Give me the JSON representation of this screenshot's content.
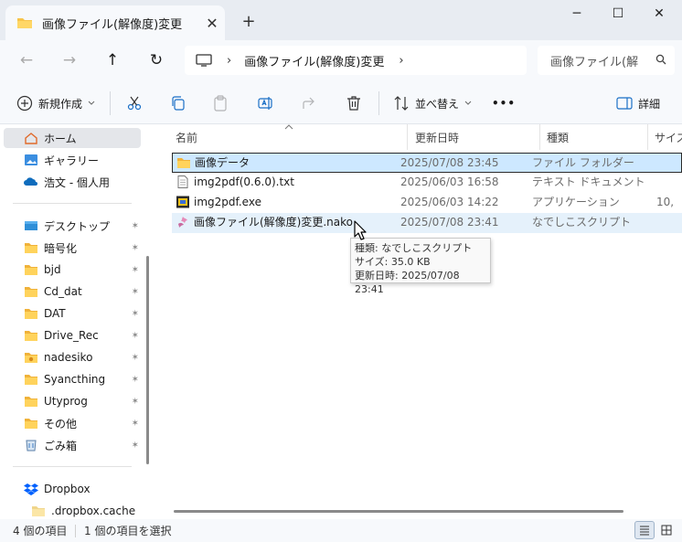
{
  "window": {
    "tab_title": "画像ファイル(解像度)変更",
    "tab_close": "✕",
    "new_tab": "+",
    "minimize": "─",
    "maximize": "☐",
    "close": "✕"
  },
  "nav": {
    "back": "←",
    "forward": "→",
    "up": "↑",
    "refresh": "↻",
    "breadcrumb": [
      "画像ファイル(解像度)変更"
    ],
    "crumb_sep": "›",
    "search_placeholder": "画像ファイル(解"
  },
  "toolbar": {
    "new_label": "新規作成",
    "sort_label": "並べ替え",
    "view_label": "詳細",
    "more": "•••"
  },
  "sidebar": {
    "items": [
      {
        "label": "ホーム",
        "icon": "home-icon",
        "selected": true
      },
      {
        "label": "ギャラリー",
        "icon": "gallery-icon"
      },
      {
        "label": "浩文 - 個人用",
        "icon": "onedrive-icon"
      },
      {
        "label": "デスクトップ",
        "icon": "desktop-icon",
        "pinned": true
      },
      {
        "label": "暗号化",
        "icon": "folder-icon",
        "pinned": true
      },
      {
        "label": "bjd",
        "icon": "folder-icon",
        "pinned": true
      },
      {
        "label": "Cd_dat",
        "icon": "folder-icon",
        "pinned": true
      },
      {
        "label": "DAT",
        "icon": "folder-icon",
        "pinned": true
      },
      {
        "label": "Drive_Rec",
        "icon": "folder-icon",
        "pinned": true
      },
      {
        "label": "nadesiko",
        "icon": "folder-icon",
        "pinned": true
      },
      {
        "label": "Syancthing",
        "icon": "folder-icon",
        "pinned": true
      },
      {
        "label": "Utyprog",
        "icon": "folder-icon",
        "pinned": true
      },
      {
        "label": "その他",
        "icon": "folder-icon",
        "pinned": true
      },
      {
        "label": "ごみ箱",
        "icon": "recycle-bin-icon",
        "pinned": true
      },
      {
        "label": "Dropbox",
        "icon": "dropbox-icon"
      },
      {
        "label": ".dropbox.cache",
        "icon": "folder-icon"
      }
    ],
    "pin_glyph": "📌"
  },
  "columns": {
    "name": "名前",
    "date": "更新日時",
    "type": "種類",
    "size": "サイズ"
  },
  "files": [
    {
      "name": "画像データ",
      "date": "2025/07/08 23:45",
      "type": "ファイル フォルダー",
      "size": "",
      "icon": "folder-icon",
      "state": "selected"
    },
    {
      "name": "img2pdf(0.6.0).txt",
      "date": "2025/06/03 16:58",
      "type": "テキスト ドキュメント",
      "size": "",
      "icon": "text-file-icon",
      "state": ""
    },
    {
      "name": "img2pdf.exe",
      "date": "2025/06/03 14:22",
      "type": "アプリケーション",
      "size": "10,",
      "icon": "exe-icon",
      "state": ""
    },
    {
      "name": "画像ファイル(解像度)変更.nako",
      "date": "2025/07/08 23:41",
      "type": "なでしこスクリプト",
      "size": "",
      "icon": "nako-script-icon",
      "state": "hover"
    }
  ],
  "tooltip": {
    "line1": "種類: なでしこスクリプト",
    "line2": "サイズ: 35.0 KB",
    "line3": "更新日時: 2025/07/08 23:41"
  },
  "status": {
    "item_count": "4 個の項目",
    "selected_count": "1 個の項目を選択"
  },
  "colors": {
    "accent_blue": "#0067c0",
    "folder_yellow": "#f8c44a",
    "selection": "#cde8ff"
  }
}
